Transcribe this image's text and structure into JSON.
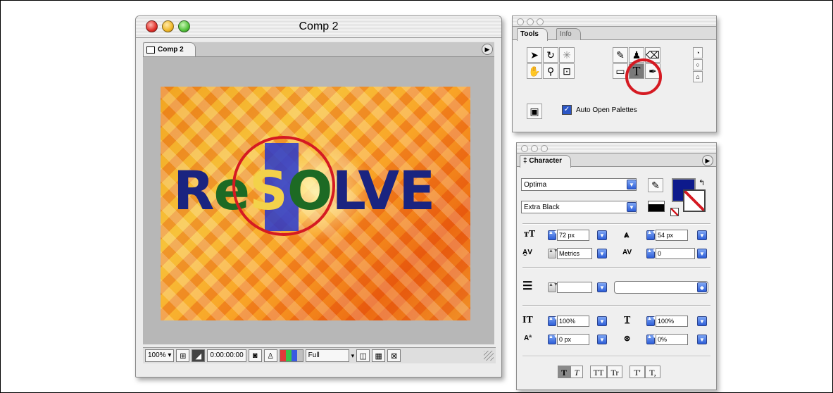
{
  "comp_window": {
    "title": "Comp 2",
    "tab_label": "Comp 2",
    "canvas_text_parts": [
      "R",
      "e",
      "S",
      "O",
      "LVE"
    ],
    "status_bar": {
      "zoom": "100%",
      "timecode": "0:00:00:00",
      "resolution": "Full"
    }
  },
  "tools_palette": {
    "tabs": [
      "Tools",
      "Info"
    ],
    "auto_open_label": "Auto Open Palettes",
    "auto_open_checked": true
  },
  "character_palette": {
    "tab": "Character",
    "font_family": "Optima",
    "font_style": "Extra Black",
    "fill_color": "#0d1a8c",
    "stroke_color": "#ffffff",
    "size": "72 px",
    "leading": "54 px",
    "kerning": "Metrics",
    "tracking": "0",
    "stroke_width": "",
    "stroke_style": "",
    "vertical_scale": "100%",
    "horizontal_scale": "100%",
    "baseline_shift": "0 px",
    "tsume": "0%",
    "style_buttons": [
      "T",
      "T",
      "TT",
      "Tr",
      "T'",
      "T,"
    ]
  },
  "colors": {
    "highlight_circle": "#d51a22",
    "text_blue": "#1a2480",
    "text_green": "#1d6a24"
  }
}
